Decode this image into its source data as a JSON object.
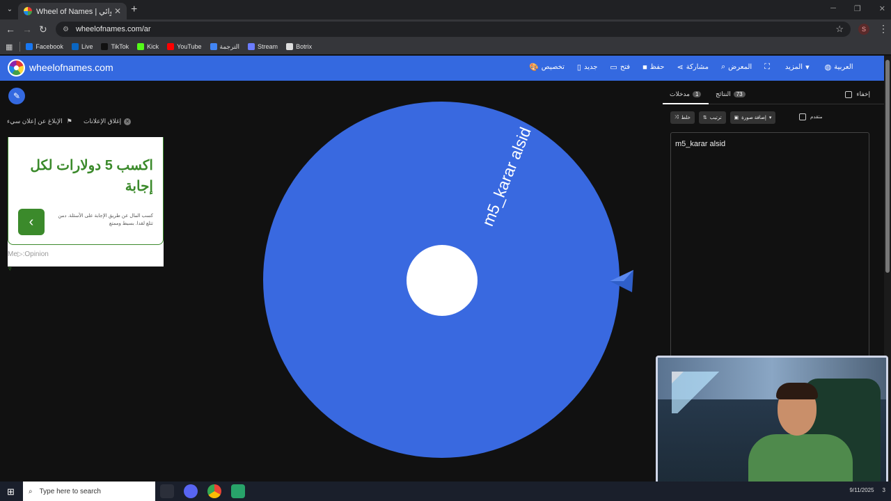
{
  "browser": {
    "tab_title": "Wheel of Names | ‏اسم العشوائي",
    "url": "wheelofnames.com/ar",
    "profile_initial": "S",
    "bookmarks": [
      {
        "label": "Facebook",
        "color": "#1877f2"
      },
      {
        "label": "Live",
        "color": "#0a66c2"
      },
      {
        "label": "TikTok",
        "color": "#111111"
      },
      {
        "label": "Kick",
        "color": "#53fc18"
      },
      {
        "label": "YouTube",
        "color": "#ff0000"
      },
      {
        "label": "الترجمة",
        "color": "#4285f4"
      },
      {
        "label": "Stream",
        "color": "#6b7cff"
      },
      {
        "label": "Botrix",
        "color": "#dddddd"
      }
    ]
  },
  "header": {
    "site_name": "wheelofnames.com",
    "menu": [
      {
        "label": "تخصيص",
        "icon": "palette-icon",
        "glyph": "🎨"
      },
      {
        "label": "جديد",
        "icon": "file-icon",
        "glyph": "▯"
      },
      {
        "label": "فتح",
        "icon": "folder-icon",
        "glyph": "▭"
      },
      {
        "label": "حفظ",
        "icon": "save-icon",
        "glyph": "■"
      },
      {
        "label": "مشاركة",
        "icon": "share-icon",
        "glyph": "⋖"
      },
      {
        "label": "المعرض",
        "icon": "search-icon",
        "glyph": "⌕"
      },
      {
        "label": "",
        "icon": "fullscreen-icon",
        "glyph": "⛶"
      },
      {
        "label": "المزيد",
        "icon": "chevron-down-icon",
        "glyph": "▾"
      },
      {
        "label": "العربية",
        "icon": "globe-icon",
        "glyph": "◍"
      }
    ]
  },
  "ad": {
    "report_label": "الإبلاغ عن إعلان سيء",
    "close_label": "إغلاق الإعلانات",
    "headline": "اكسب 5 دولارات لكل إجابة",
    "subtext": "كسب المال عن طريق الإجابة على الأسئلة. دمن تتلع لقدا. بسيط وممتع",
    "brand": "Me▷:Opinion"
  },
  "wheel": {
    "entry_label": "m5_karar alsid",
    "color": "#3969e0"
  },
  "panel": {
    "tab_entries": "مدخلات",
    "tab_entries_count": "1",
    "tab_results": "النتائج",
    "tab_results_count": "73",
    "hide_label": "إخفاء",
    "shuffle_label": "خلط",
    "sort_label": "ترتيب",
    "add_image_label": "إضافة صورة",
    "advanced_label": "متقدم",
    "entries_text": "m5_karar alsid"
  },
  "taskbar": {
    "search_placeholder": "Type here to search",
    "date": "9/11/2025",
    "notification_count": "3"
  }
}
